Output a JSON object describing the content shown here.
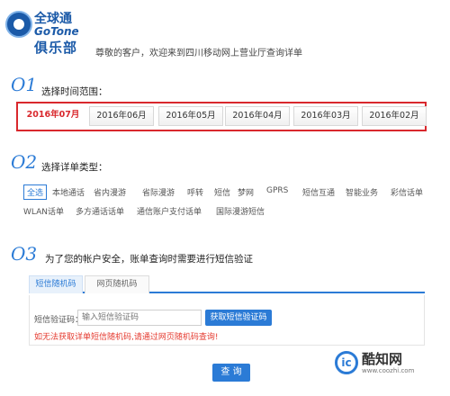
{
  "brand": {
    "name_cn": "全球通",
    "name_en": "GoTone",
    "club": "俱乐部"
  },
  "welcome": "尊敬的客户，欢迎来到四川移动网上营业厅查询详单",
  "step1": {
    "num": "O1",
    "title": "选择时间范围："
  },
  "months": [
    "2016年07月",
    "2016年06月",
    "2016年05月",
    "2016年04月",
    "2016年03月",
    "2016年02月"
  ],
  "selected_month": "2016年07月",
  "step2": {
    "num": "O2",
    "title": "选择详单类型："
  },
  "types_row1": [
    "全选",
    "本地通话",
    "省内漫游",
    "省际漫游",
    "呼转",
    "短信",
    "梦网",
    "GPRS",
    "短信互通",
    "智能业务",
    "彩信话单"
  ],
  "types_row2": [
    "WLAN话单",
    "多方通话话单",
    "通信账户支付话单",
    "国际漫游短信"
  ],
  "step3": {
    "num": "O3",
    "title": "为了您的帐户安全，账单查询时需要进行短信验证"
  },
  "verify": {
    "tab_sms": "短信随机码",
    "tab_web": "网页随机码",
    "sms_label": "短信验证码：",
    "sms_placeholder": "输入短信验证码",
    "get_code_button": "获取短信验证码",
    "warning": "如无法获取详单短信随机码,请通过网页随机码查询!"
  },
  "query_button": "查 询",
  "watermark": {
    "mark": "ic",
    "name": "酷知网",
    "url": "www.coozhi.com"
  },
  "colors": {
    "accent": "#2b7bd6",
    "highlight": "#d9282d",
    "warning": "#e53a2f"
  }
}
